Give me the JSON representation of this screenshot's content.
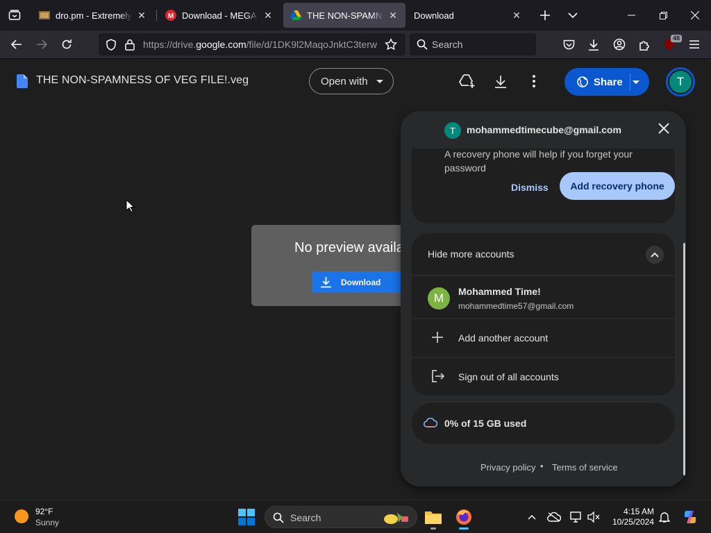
{
  "browser": {
    "tabs": [
      {
        "title": "dro.pm - Extremely Sho",
        "active": false
      },
      {
        "title": "Download - MEGA",
        "active": false
      },
      {
        "title": "THE NON-SPAMNESS O",
        "active": true
      },
      {
        "title": "Download",
        "active": false
      }
    ],
    "url": {
      "prefix": "https://drive.",
      "domain": "google.com",
      "path": "/file/d/1DK9l2MaqoJnktC3terw"
    },
    "search_placeholder": "Search",
    "extensions_badge": "48"
  },
  "drive": {
    "file_title": "THE NON-SPAMNESS OF VEG FILE!.veg",
    "open_with_label": "Open with",
    "share_label": "Share",
    "avatar_letter": "T",
    "preview_message": "No preview available",
    "download_label": "Download"
  },
  "account_panel": {
    "avatar_letter": "T",
    "email": "mohammedtimecube@gmail.com",
    "recovery_text": "A recovery phone will help if you forget your password",
    "dismiss_label": "Dismiss",
    "add_phone_label": "Add recovery phone",
    "hide_accounts_label": "Hide more accounts",
    "other_account": {
      "avatar_letter": "M",
      "name": "Mohammed Time!",
      "email": "mohammedtime57@gmail.com"
    },
    "add_account_label": "Add another account",
    "sign_out_label": "Sign out of all accounts",
    "storage_label": "0% of 15 GB used",
    "privacy_label": "Privacy policy",
    "dot": "•",
    "terms_label": "Terms of service"
  },
  "taskbar": {
    "temperature": "92°F",
    "condition": "Sunny",
    "search_placeholder": "Search",
    "time": "4:15 AM",
    "date": "10/25/2024"
  },
  "colors": {
    "accent": "#0b57d0",
    "drive_download": "#1a73e8",
    "recovery_button": "#a8c7fa",
    "avatar_teal": "#00897b",
    "avatar_green": "#7cb342"
  }
}
